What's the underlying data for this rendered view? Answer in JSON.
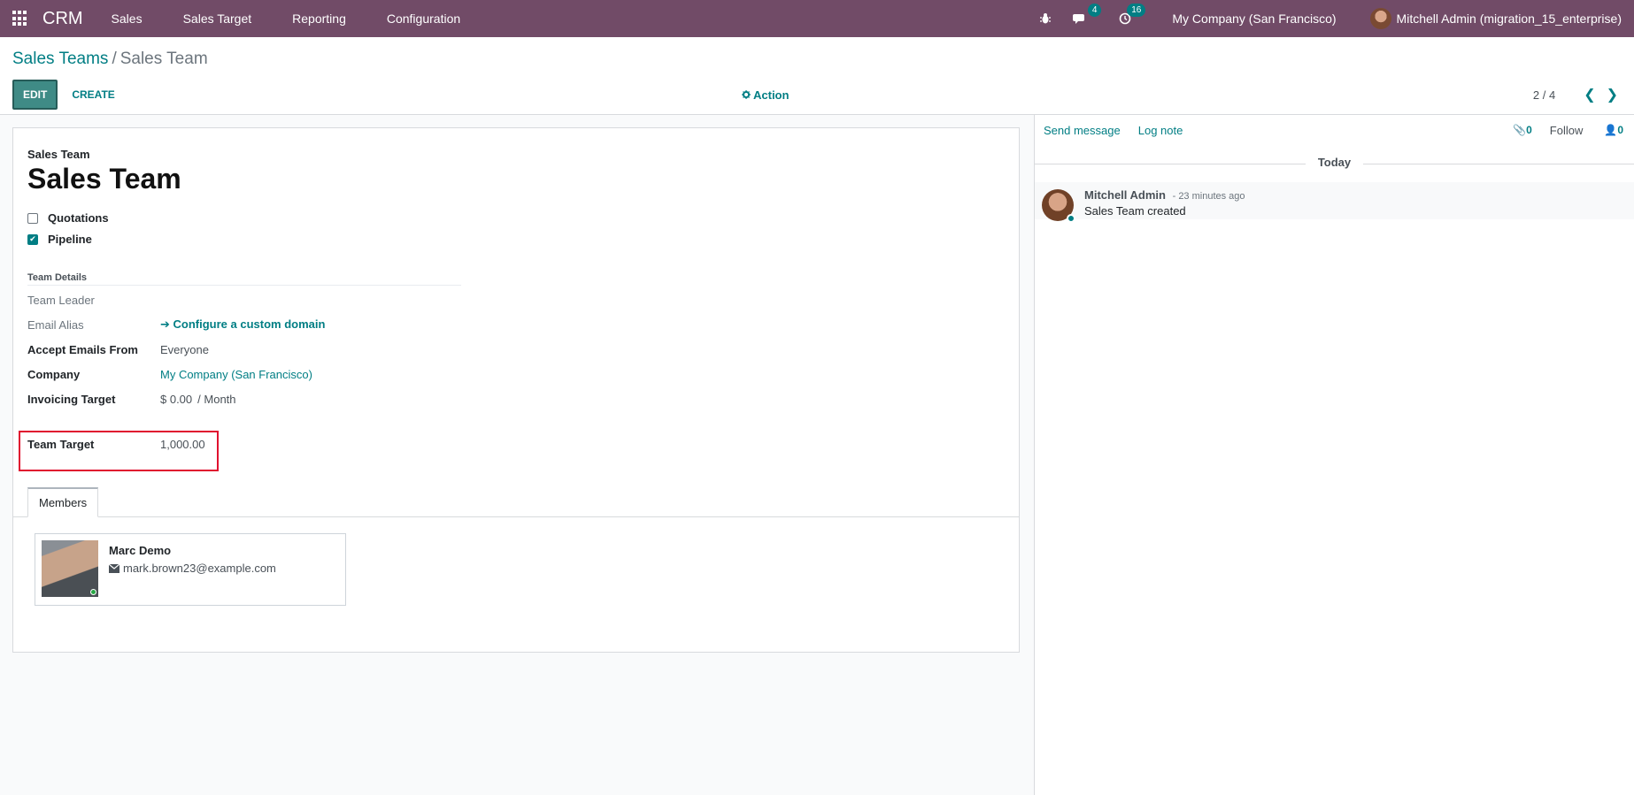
{
  "navbar": {
    "brand": "CRM",
    "menu": [
      "Sales",
      "Sales Target",
      "Reporting",
      "Configuration"
    ],
    "messages_count": "4",
    "activities_count": "16",
    "company": "My Company (San Francisco)",
    "user": "Mitchell Admin (migration_15_enterprise)"
  },
  "breadcrumb": {
    "parent": "Sales Teams",
    "separator": "/",
    "current": "Sales Team"
  },
  "toolbar": {
    "edit_label": "EDIT",
    "create_label": "CREATE",
    "action_label": "Action",
    "pager_value": "2 / 4"
  },
  "form": {
    "name_label": "Sales Team",
    "name": "Sales Team",
    "checks": [
      {
        "label": "Quotations",
        "checked": false
      },
      {
        "label": "Pipeline",
        "checked": true
      }
    ],
    "group_title": "Team Details",
    "fields": {
      "team_leader_label": "Team Leader",
      "email_alias_label": "Email Alias",
      "email_alias_value": "Configure a custom domain",
      "accept_emails_label": "Accept Emails From",
      "accept_emails_value": "Everyone",
      "company_label": "Company",
      "company_value": "My Company (San Francisco)",
      "invoicing_target_label": "Invoicing Target",
      "invoicing_target_value": "$ 0.00",
      "invoicing_target_unit": "/ Month",
      "team_target_label": "Team Target",
      "team_target_value": "1,000.00"
    },
    "tab_members": "Members",
    "members": [
      {
        "name": "Marc Demo",
        "email": "mark.brown23@example.com"
      }
    ]
  },
  "chatter": {
    "send_message": "Send message",
    "log_note": "Log note",
    "attachments_count": "0",
    "follow": "Follow",
    "followers_count": "0",
    "date_separator": "Today",
    "messages": [
      {
        "author": "Mitchell Admin",
        "time": "- 23 minutes ago",
        "body": "Sales Team created"
      }
    ]
  },
  "colors": {
    "navbar": "#714B67",
    "accent": "#017E84",
    "highlight_box": "#e0102f"
  }
}
